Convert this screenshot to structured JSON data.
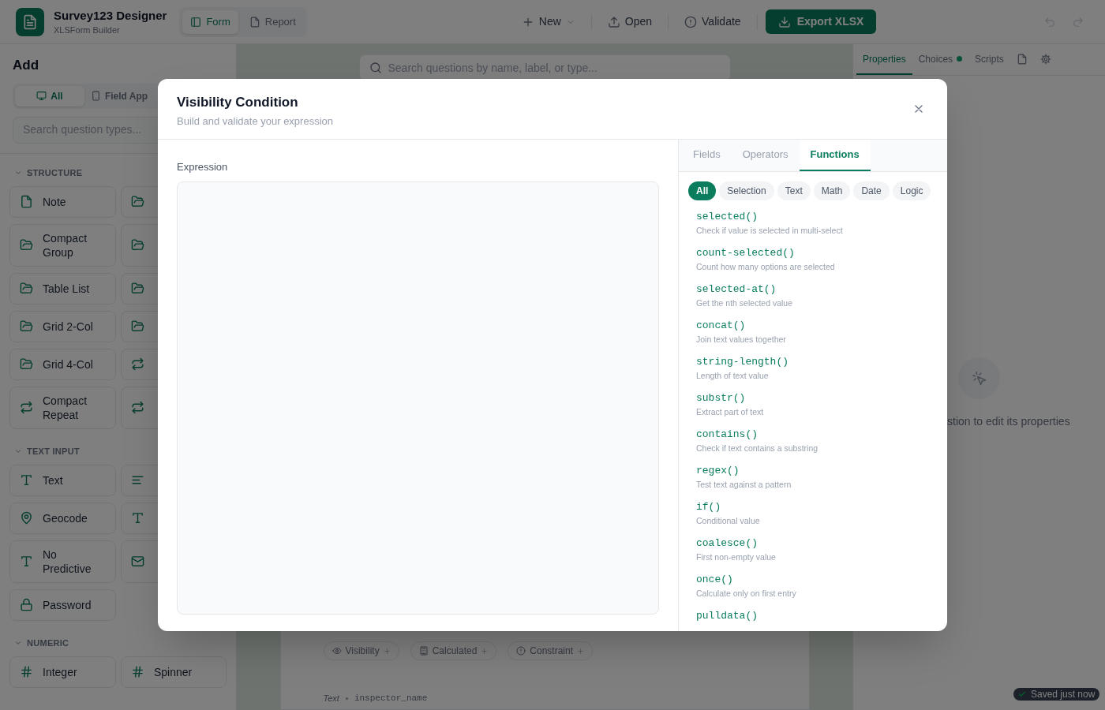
{
  "header": {
    "title": "Survey123 Designer",
    "subtitle": "XLSForm Builder",
    "view_tabs": [
      {
        "label": "Form",
        "kind": "form",
        "selected": true
      },
      {
        "label": "Report",
        "kind": "report",
        "selected": false
      }
    ],
    "actions": [
      {
        "label": "New",
        "kind": "menu"
      },
      {
        "label": "Open",
        "kind": "open"
      },
      {
        "label": "Validate",
        "kind": "validate"
      },
      {
        "label": "Export XLSX",
        "kind": "primary"
      }
    ],
    "history": [
      {
        "kind": "undo",
        "disabled": true
      },
      {
        "kind": "redo",
        "disabled": true
      }
    ]
  },
  "sidebar": {
    "title": "Add",
    "platform_tabs": [
      {
        "label": "All",
        "kind": "all",
        "selected": true
      },
      {
        "label": "Field App",
        "kind": "field",
        "selected": false
      }
    ],
    "search": {
      "placeholder": "Search question types..."
    },
    "sections": [
      {
        "title": "STRUCTURE",
        "expanded": true,
        "items": [
          {
            "label": "Note",
            "kind": "note"
          },
          {
            "kind": "group"
          },
          {
            "label": "Compact Group",
            "kind": "group"
          },
          {
            "kind": "group"
          },
          {
            "label": "Table List",
            "kind": "group"
          },
          {
            "kind": "group"
          },
          {
            "label": "Grid 2-Col",
            "kind": "group"
          },
          {
            "kind": "group"
          },
          {
            "label": "Grid 4-Col",
            "kind": "group"
          },
          {
            "kind": "repeat"
          },
          {
            "label": "Compact Repeat",
            "kind": "repeat"
          },
          {
            "kind": "repeat"
          }
        ]
      },
      {
        "title": "TEXT INPUT",
        "expanded": true,
        "items": [
          {
            "label": "Text",
            "kind": "text"
          },
          {
            "kind": "multiline"
          },
          {
            "label": "Geocode",
            "kind": "geocode"
          },
          {
            "kind": "text"
          },
          {
            "label": "No Predictive",
            "kind": "text"
          },
          {
            "kind": "email"
          },
          {
            "label": "Password",
            "kind": "password"
          }
        ]
      },
      {
        "title": "NUMERIC",
        "expanded": true,
        "items": [
          {
            "label": "Integer",
            "kind": "number"
          },
          {
            "label": "Spinner",
            "kind": "number"
          }
        ]
      }
    ]
  },
  "canvas": {
    "search": {
      "placeholder": "Search questions by name, label, or type..."
    },
    "logic_chips": [
      {
        "label": "Visibility",
        "kind": "visibility"
      },
      {
        "label": "Calculated",
        "kind": "calculated"
      },
      {
        "label": "Constraint",
        "kind": "constraint"
      }
    ],
    "question": {
      "type": "Text",
      "name": "inspector_name"
    }
  },
  "properties_panel": {
    "tabs": [
      {
        "label": "Properties",
        "kind": "text",
        "selected": true,
        "dot": false
      },
      {
        "label": "Choices",
        "kind": "text",
        "selected": false,
        "dot": true
      },
      {
        "label": "Scripts",
        "kind": "text",
        "selected": false,
        "dot": false
      },
      {
        "kind": "file",
        "selected": false,
        "dot": false
      },
      {
        "kind": "settings",
        "selected": false,
        "dot": false
      }
    ],
    "empty_message": "stion to edit its properties"
  },
  "toast": {
    "text": "Saved just now"
  },
  "dialog": {
    "title": "Visibility Condition",
    "subtitle": "Build and validate your expression",
    "expression_label": "Expression",
    "tabs": [
      {
        "label": "Fields",
        "selected": false
      },
      {
        "label": "Operators",
        "selected": false
      },
      {
        "label": "Functions",
        "selected": true
      }
    ],
    "categories": [
      {
        "label": "All",
        "selected": true
      },
      {
        "label": "Selection",
        "selected": false
      },
      {
        "label": "Text",
        "selected": false
      },
      {
        "label": "Math",
        "selected": false
      },
      {
        "label": "Date",
        "selected": false
      },
      {
        "label": "Logic",
        "selected": false
      }
    ],
    "functions": [
      {
        "name": "selected()",
        "description": "Check if value is selected in multi-select"
      },
      {
        "name": "count-selected()",
        "description": "Count how many options are selected"
      },
      {
        "name": "selected-at()",
        "description": "Get the nth selected value"
      },
      {
        "name": "concat()",
        "description": "Join text values together"
      },
      {
        "name": "string-length()",
        "description": "Length of text value"
      },
      {
        "name": "substr()",
        "description": "Extract part of text"
      },
      {
        "name": "contains()",
        "description": "Check if text contains a substring"
      },
      {
        "name": "regex()",
        "description": "Test text against a pattern"
      },
      {
        "name": "if()",
        "description": "Conditional value"
      },
      {
        "name": "coalesce()",
        "description": "First non-empty value"
      },
      {
        "name": "once()",
        "description": "Calculate only on first entry"
      },
      {
        "name": "pulldata()"
      }
    ]
  }
}
